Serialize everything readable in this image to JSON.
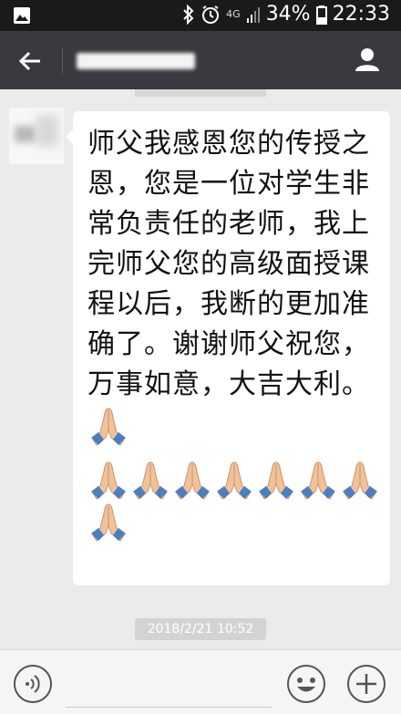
{
  "status_bar": {
    "network": "4G",
    "battery_percent": "34%",
    "time": "22:33"
  },
  "chat": {
    "message_text": "师父我感恩您的传授之恩，您是一位对学生非常负责任的老师，我上完师父您的高级面授课程以后，我断的更加准确了。谢谢师父祝您，万事如意，大吉大利。",
    "timestamp": "2018/2/21 10:52"
  },
  "icons": {
    "back": "back-arrow-icon",
    "profile": "person-icon",
    "voice": "voice-icon",
    "emoji": "smiley-icon",
    "plus": "plus-icon",
    "praying_hands": "praying-hands-icon"
  },
  "praying_hands_count": 9,
  "colors": {
    "title_bar": "#393a3f",
    "status_bar": "#1a1a1a",
    "chat_background": "#ebebeb",
    "bubble": "#ffffff"
  }
}
